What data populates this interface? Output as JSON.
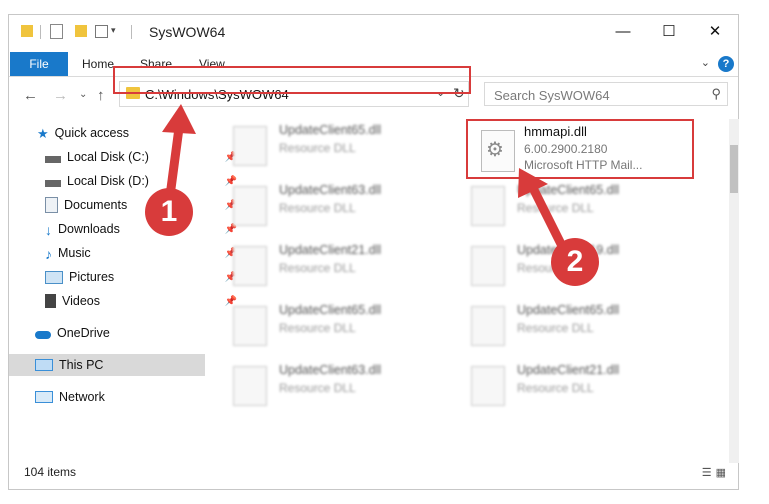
{
  "window": {
    "title": "SysWOW64",
    "minimize": "—",
    "maximize": "☐",
    "close": "✕"
  },
  "ribbon": {
    "tabs": [
      "File",
      "Home",
      "Share",
      "View"
    ],
    "help": "?",
    "expand": "⌄"
  },
  "nav": {
    "back": "←",
    "forward": "→",
    "recent": "⌄",
    "up": "↑"
  },
  "address": {
    "path": "C:\\Windows\\SysWOW64",
    "dropdown": "⌄",
    "refresh": "↻"
  },
  "search": {
    "placeholder": "Search SysWOW64",
    "icon": "⚲"
  },
  "sidebar": {
    "items": [
      {
        "label": "Quick access",
        "icon": "star-icon",
        "color": "#1979ca"
      },
      {
        "label": "Local Disk (C:)",
        "icon": "drive-icon",
        "color": "#555555",
        "pinned": true
      },
      {
        "label": "Local Disk (D:)",
        "icon": "drive-icon",
        "color": "#555555",
        "pinned": true
      },
      {
        "label": "Documents",
        "icon": "documents-icon",
        "color": "#7a8fa6",
        "pinned": true
      },
      {
        "label": "Downloads",
        "icon": "downloads-icon",
        "color": "#1979ca",
        "pinned": true
      },
      {
        "label": "Music",
        "icon": "music-icon",
        "color": "#1979ca",
        "pinned": true
      },
      {
        "label": "Pictures",
        "icon": "pictures-icon",
        "color": "#4a90c8",
        "pinned": true
      },
      {
        "label": "Videos",
        "icon": "videos-icon",
        "color": "#444444",
        "pinned": true
      },
      {
        "label": "OneDrive",
        "icon": "cloud-icon",
        "color": "#1979ca"
      },
      {
        "label": "This PC",
        "icon": "computer-icon",
        "color": "#3a8fd8",
        "selected": true
      },
      {
        "label": "Network",
        "icon": "network-icon",
        "color": "#3a8fd8"
      }
    ]
  },
  "files": [
    {
      "name": "UpdateClient65.dll",
      "desc": "Resource DLL"
    },
    {
      "name": "UpdateClient63.dll",
      "desc": "Resource DLL"
    },
    {
      "name": "UpdateClient65.dll",
      "desc": "Resource DLL"
    },
    {
      "name": "UpdateClient21.dll",
      "desc": "Resource DLL"
    },
    {
      "name": "UpdateClient19.dll",
      "desc": "Resource DLL"
    },
    {
      "name": "UpdateClient65.dll",
      "desc": "Resource DLL"
    },
    {
      "name": "UpdateClient65.dll",
      "desc": "Resource DLL"
    },
    {
      "name": "UpdateClient63.dll",
      "desc": "Resource DLL"
    },
    {
      "name": "UpdateClient21.dll",
      "desc": "Resource DLL"
    }
  ],
  "highlighted_file": {
    "name": "hmmapi.dll",
    "version": "6.00.2900.2180",
    "desc": "Microsoft HTTP Mail..."
  },
  "status": {
    "count": "104 items"
  },
  "annotations": {
    "step1": "1",
    "step2": "2",
    "color": "#d83b3b"
  }
}
